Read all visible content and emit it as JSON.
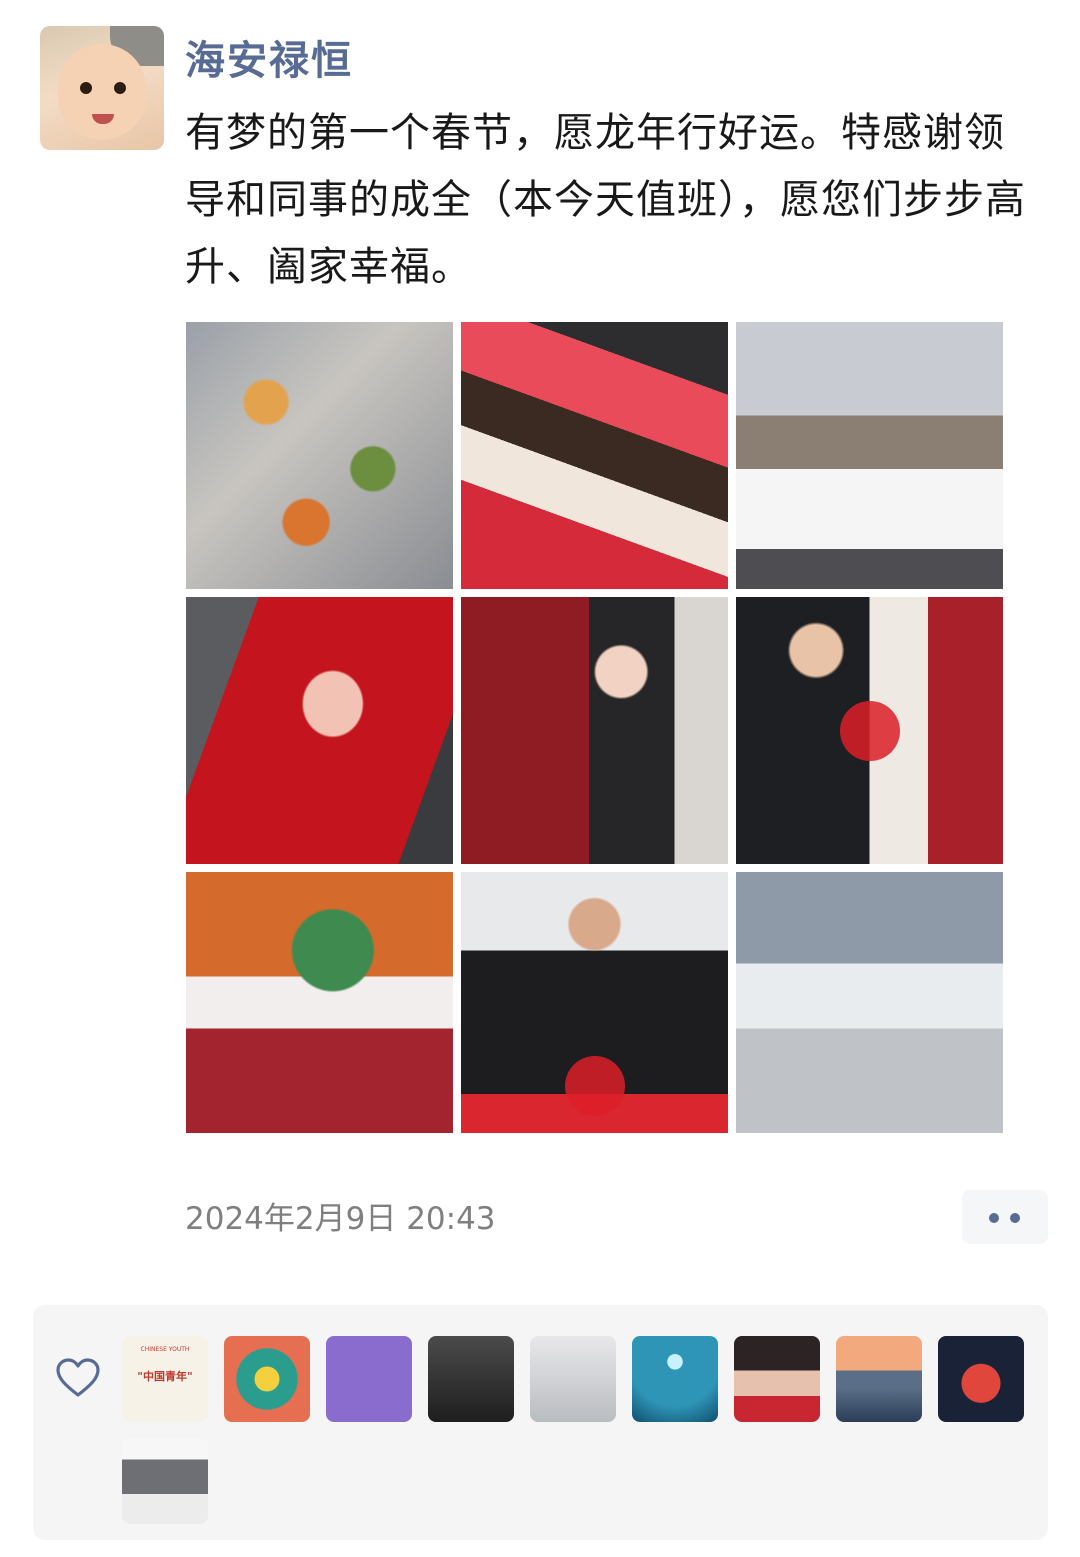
{
  "post": {
    "author": "海安禄恒",
    "content": "有梦的第一个春节，愿龙年行好运。特感谢领导和同事的成全（本今天值班），愿您们步步高升、阖家幸福。",
    "timestamp": "2024年2月9日 20:43",
    "photos": [
      "p1",
      "p2",
      "p3",
      "p4",
      "p5",
      "p6",
      "p7",
      "p8",
      "p9"
    ]
  },
  "likes": {
    "first_liker_label": "\"中国青年\"",
    "first_liker_tagline": "CHINESE YOUTH"
  },
  "icons": {
    "more": "more-dots-icon",
    "like": "heart-outline-icon"
  },
  "colors": {
    "name": "#576b95",
    "text": "#191919",
    "time": "#7f7f7f",
    "likes_bg": "#f5f5f5"
  }
}
